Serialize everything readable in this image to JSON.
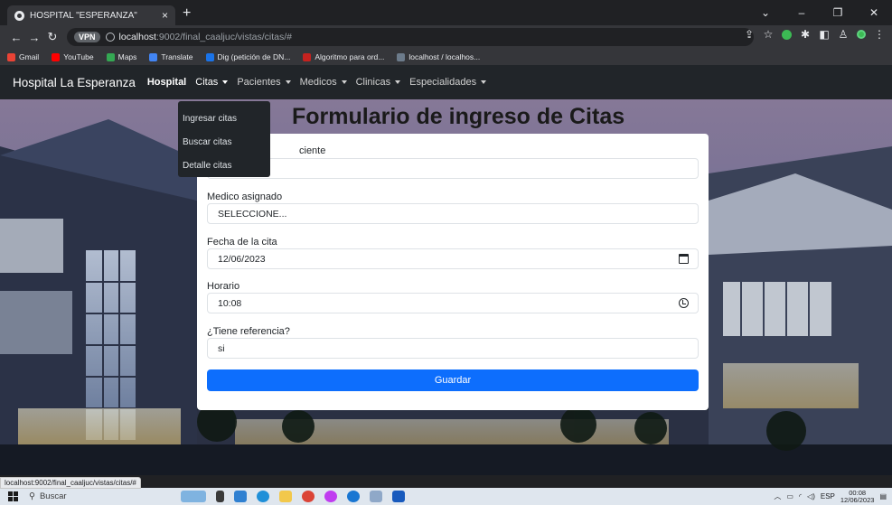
{
  "browser": {
    "tab_title": "HOSPITAL \"ESPERANZA\"",
    "tab_close": "×",
    "new_tab": "+",
    "url_host": "localhost",
    "url_path": ":9002/final_caaljuc/vistas/citas/#",
    "vpn_badge": "VPN",
    "win_minimize": "–",
    "win_maximize": "❐",
    "win_close": "✕",
    "bookmarks": [
      {
        "label": "Gmail",
        "color": "#ea4335"
      },
      {
        "label": "YouTube",
        "color": "#ff0000"
      },
      {
        "label": "Maps",
        "color": "#34a853"
      },
      {
        "label": "Translate",
        "color": "#4285f4"
      },
      {
        "label": "Dig (petición de DN...",
        "color": "#1a73e8"
      },
      {
        "label": "Algoritmo para ord...",
        "color": "#c5221f"
      },
      {
        "label": "localhost / localhos...",
        "color": "#6c7b8b"
      }
    ],
    "status_url": "localhost:9002/final_caaljuc/vistas/citas/#"
  },
  "navbar": {
    "brand": "Hospital La Esperanza",
    "links": [
      {
        "label": "Hospital",
        "bold": true,
        "dropdown": false
      },
      {
        "label": "Citas",
        "dropdown": true
      },
      {
        "label": "Pacientes",
        "dropdown": true
      },
      {
        "label": "Medicos",
        "dropdown": true
      },
      {
        "label": "Clinicas",
        "dropdown": true
      },
      {
        "label": "Especialidades",
        "dropdown": true
      }
    ],
    "citas_menu": [
      "Ingresar citas",
      "Buscar citas",
      "Detalle citas"
    ]
  },
  "page": {
    "title": "Formulario de ingreso de Citas"
  },
  "form": {
    "paciente_label_visible": "ciente",
    "paciente_value": "",
    "medico_label": "Medico asignado",
    "medico_value": "SELECCIONE...",
    "fecha_label": "Fecha de la cita",
    "fecha_value": "12/06/2023",
    "horario_label": "Horario",
    "horario_value": "10:08",
    "referencia_label": "¿Tiene referencia?",
    "referencia_value": "si",
    "submit_label": "Guardar"
  },
  "taskbar": {
    "search_label": "Buscar",
    "language": "ESP",
    "time": "00:08",
    "date": "12/06/2023"
  },
  "colors": {
    "primary": "#0d6efd",
    "navbar_bg": "#212529"
  }
}
